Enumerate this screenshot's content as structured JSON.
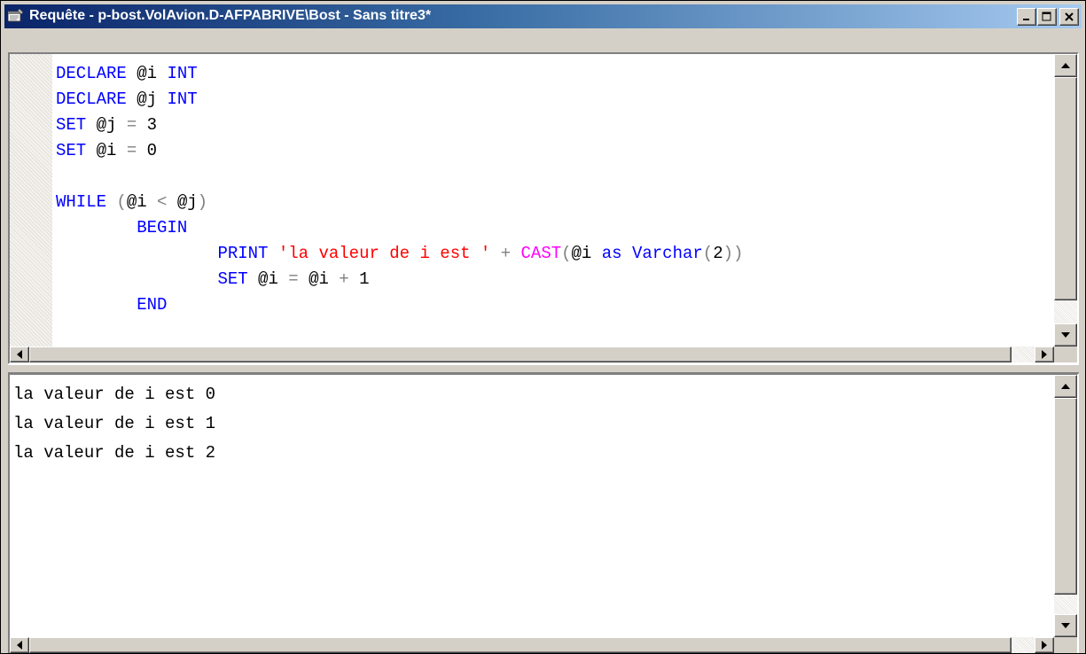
{
  "window": {
    "title": "Requête - p-bost.VolAvion.D-AFPABRIVE\\Bost - Sans titre3*",
    "icon": "query-window-icon",
    "buttons": [
      "minimize",
      "maximize",
      "close"
    ]
  },
  "editor": {
    "lines": [
      [
        {
          "t": "DECLARE ",
          "c": "kw"
        },
        {
          "t": "@i ",
          "c": "txt"
        },
        {
          "t": "INT",
          "c": "kw"
        }
      ],
      [
        {
          "t": "DECLARE ",
          "c": "kw"
        },
        {
          "t": "@j ",
          "c": "txt"
        },
        {
          "t": "INT",
          "c": "kw"
        }
      ],
      [
        {
          "t": "SET ",
          "c": "kw"
        },
        {
          "t": "@j ",
          "c": "txt"
        },
        {
          "t": "= ",
          "c": "op"
        },
        {
          "t": "3",
          "c": "txt"
        }
      ],
      [
        {
          "t": "SET ",
          "c": "kw"
        },
        {
          "t": "@i ",
          "c": "txt"
        },
        {
          "t": "= ",
          "c": "op"
        },
        {
          "t": "0",
          "c": "txt"
        }
      ],
      [],
      [
        {
          "t": "WHILE ",
          "c": "kw"
        },
        {
          "t": "(",
          "c": "op"
        },
        {
          "t": "@i ",
          "c": "txt"
        },
        {
          "t": "< ",
          "c": "op"
        },
        {
          "t": "@j",
          "c": "txt"
        },
        {
          "t": ")",
          "c": "op"
        }
      ],
      [
        {
          "t": "        ",
          "c": "txt"
        },
        {
          "t": "BEGIN",
          "c": "kw"
        }
      ],
      [
        {
          "t": "                ",
          "c": "txt"
        },
        {
          "t": "PRINT ",
          "c": "kw"
        },
        {
          "t": "'la valeur de i est ' ",
          "c": "str"
        },
        {
          "t": "+ ",
          "c": "op"
        },
        {
          "t": "CAST",
          "c": "fn"
        },
        {
          "t": "(",
          "c": "op"
        },
        {
          "t": "@i ",
          "c": "txt"
        },
        {
          "t": "as ",
          "c": "kw"
        },
        {
          "t": "Varchar",
          "c": "kw"
        },
        {
          "t": "(",
          "c": "op"
        },
        {
          "t": "2",
          "c": "txt"
        },
        {
          "t": "))",
          "c": "op"
        }
      ],
      [
        {
          "t": "                ",
          "c": "txt"
        },
        {
          "t": "SET ",
          "c": "kw"
        },
        {
          "t": "@i ",
          "c": "txt"
        },
        {
          "t": "= ",
          "c": "op"
        },
        {
          "t": "@i ",
          "c": "txt"
        },
        {
          "t": "+ ",
          "c": "op"
        },
        {
          "t": "1",
          "c": "txt"
        }
      ],
      [
        {
          "t": "        ",
          "c": "txt"
        },
        {
          "t": "END",
          "c": "kw"
        }
      ]
    ]
  },
  "output": {
    "lines": [
      "la valeur de i est 0",
      "la valeur de i est 1",
      "la valeur de i est 2"
    ]
  },
  "colors": {
    "keyword": "#0000ff",
    "string": "#ff0000",
    "function": "#ff00ff",
    "operator": "#808080",
    "title_bar_start": "#0a246a",
    "title_bar_end": "#a6caf0"
  }
}
